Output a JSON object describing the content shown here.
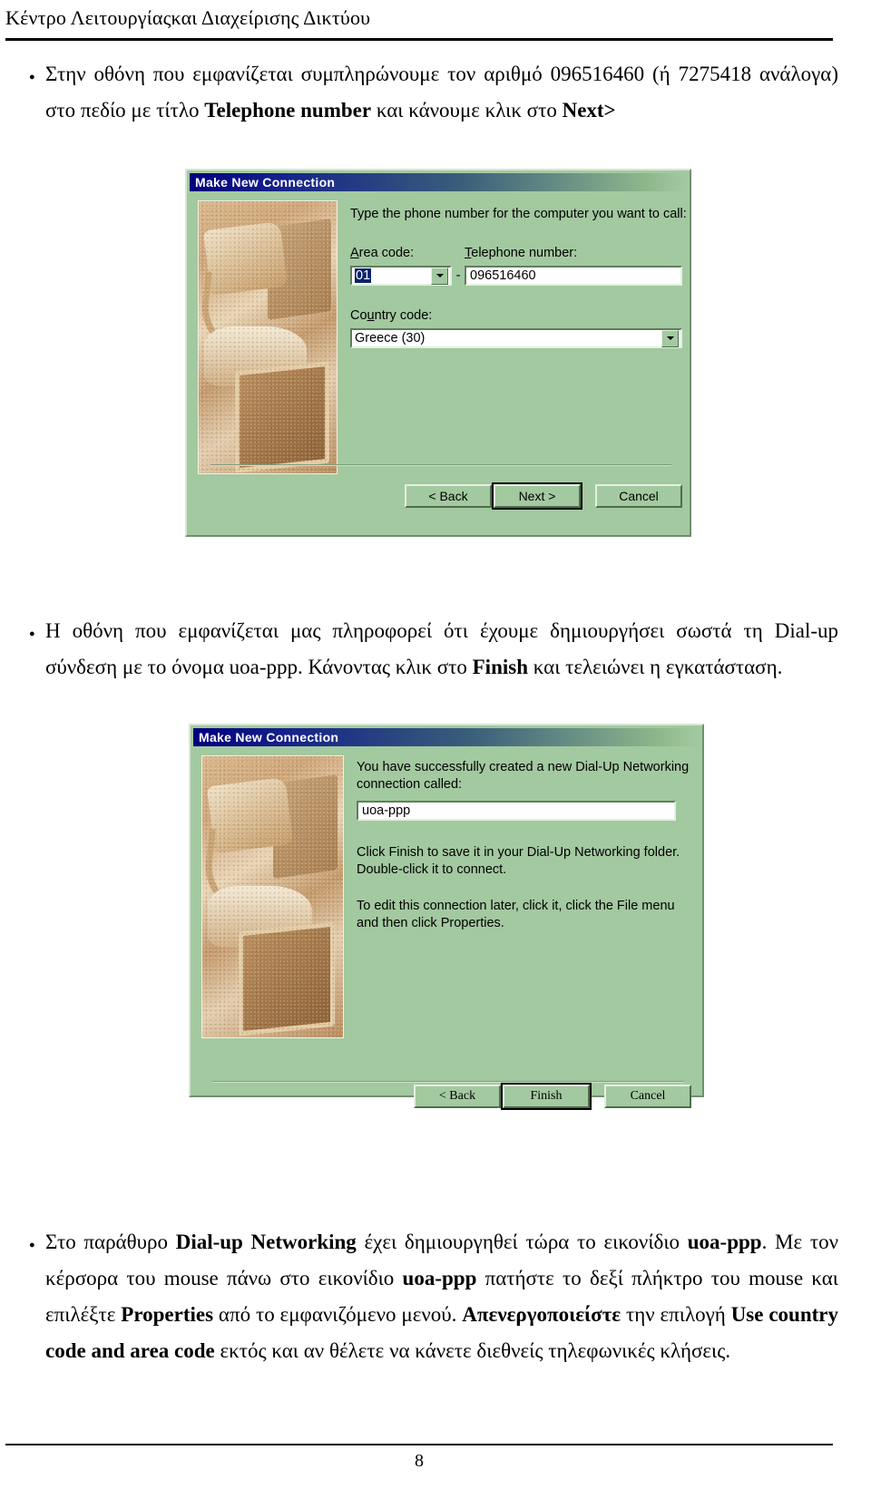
{
  "header": {
    "title": "Κέντρο Λειτουργίαςκαι Διαχείρισης Δικτύου"
  },
  "bullets": {
    "b1_part1": "Στην οθόνη που εμφανίζεται συμπληρώνουμε τον αριθμό 096516460 (ή 7275418 ανάλογα) στο πεδίο με τίτλο ",
    "b1_bold1": "Telephone number",
    "b1_part2": " και κάνουμε κλικ στο ",
    "b1_bold2": "Next>",
    "b2_part1": "Η οθόνη που εμφανίζεται μας πληροφορεί ότι έχουμε δημιουργήσει σωστά τη Dial-up σύνδεση με το όνομα uoa-ppp. Κάνοντας κλικ στο ",
    "b2_bold1": "Finish",
    "b2_part2": " και τελειώνει η εγκατάσταση.",
    "b3_part1": "Στο παράθυρο ",
    "b3_bold1": "Dial-up Networking",
    "b3_part2": " έχει δημιουργηθεί τώρα το εικονίδιο ",
    "b3_bold2": "uoa-ppp",
    "b3_part3": ". Με τον κέρσορα του mouse πάνω στο εικονίδιο ",
    "b3_bold3": "uoa-ppp",
    "b3_part4": " πατήστε το δεξί πλήκτρο του mouse και επιλέξτε ",
    "b3_bold4": "Properties",
    "b3_part5": " από το εμφανιζόμενο μενού. ",
    "b3_bold5": "Απενεργοποιείστε",
    "b3_part6": " την επιλογή ",
    "b3_bold6": "Use country code and area code",
    "b3_part7": " εκτός και αν θέλετε να κάνετε διεθνείς τηλεφωνικές κλήσεις."
  },
  "dialog1": {
    "title": "Make New Connection",
    "prompt": "Type the phone number for the computer you want to call:",
    "area_code_label": "Area code:",
    "area_code_value": "01",
    "dash": "-",
    "telephone_label": "Telephone number:",
    "telephone_value": "096516460",
    "country_code_label": "Country code:",
    "country_code_value": "Greece (30)",
    "buttons": {
      "back": "< Back",
      "next": "Next >",
      "cancel": "Cancel"
    }
  },
  "dialog2": {
    "title": "Make New Connection",
    "line1": "You have successfully created a new Dial-Up Networking",
    "line2": "connection called:",
    "connection_name": "uoa-ppp",
    "line3": "Click Finish to save it in your Dial-Up Networking folder.",
    "line4": "Double-click it to connect.",
    "line5": "To edit this connection later, click it, click the File menu",
    "line6": "and then click Properties.",
    "buttons": {
      "back": "< Back",
      "finish": "Finish",
      "cancel": "Cancel"
    }
  },
  "footer": {
    "page_number": "8"
  },
  "colors": {
    "dialog_face": "#a3c9a0",
    "titlebar_start": "#00007e",
    "titlebar_end": "#a3c9a0",
    "selection": "#0a246a",
    "field_bg": "#ffffff"
  }
}
